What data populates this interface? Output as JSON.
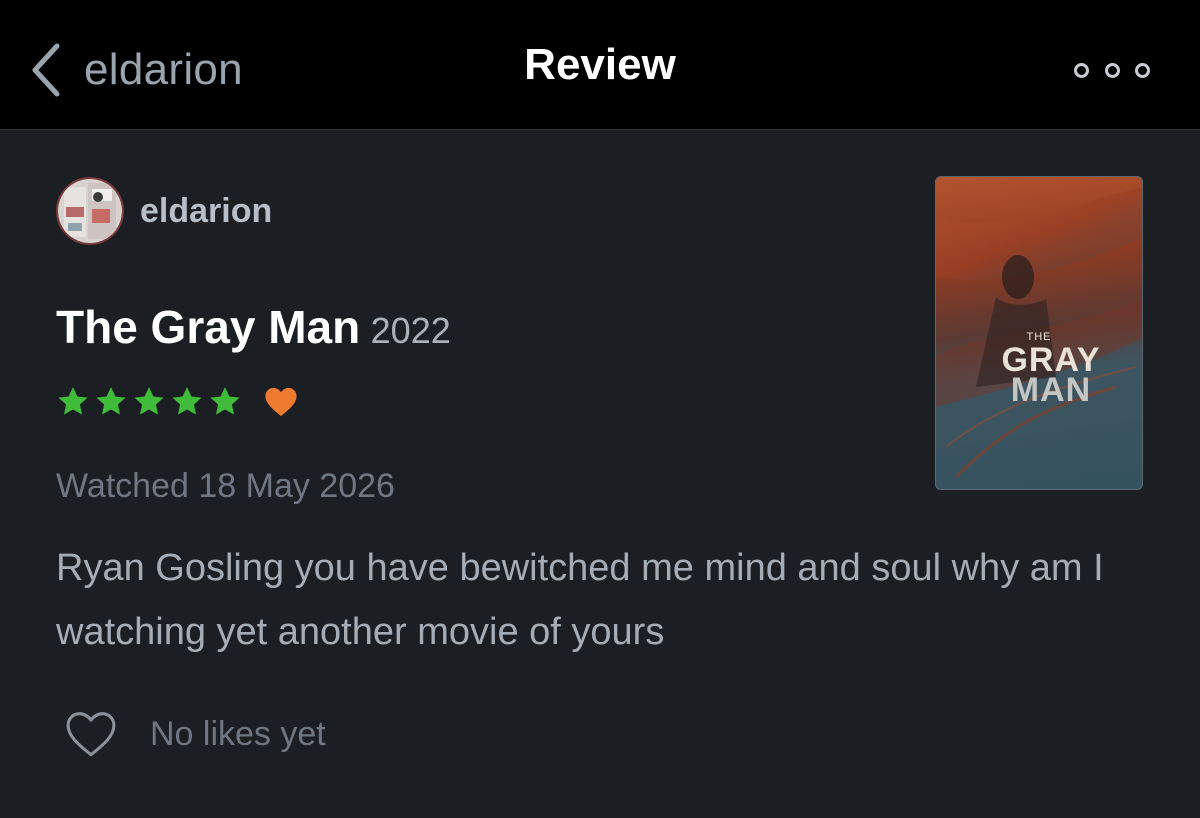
{
  "nav": {
    "back_label": "eldarion",
    "title": "Review",
    "back_icon": "chevron-left-icon",
    "more_icon": "more-dots-icon"
  },
  "review": {
    "username": "eldarion",
    "film_title": "The Gray Man",
    "film_year": "2022",
    "rating": 5,
    "rating_max": 5,
    "liked": true,
    "watched": "Watched 18 May 2026",
    "text": "Ryan Gosling you have bewitched me mind and soul why am I watching yet another movie of yours",
    "likes_label": "No likes yet"
  },
  "poster": {
    "line1": "THE",
    "line2": "GRAY",
    "line3": "MAN"
  },
  "colors": {
    "background": "#1b1e22",
    "nav_background": "#000000",
    "star": "#40bc3a",
    "heart": "#ee7a30",
    "muted_text": "#6f7882"
  }
}
